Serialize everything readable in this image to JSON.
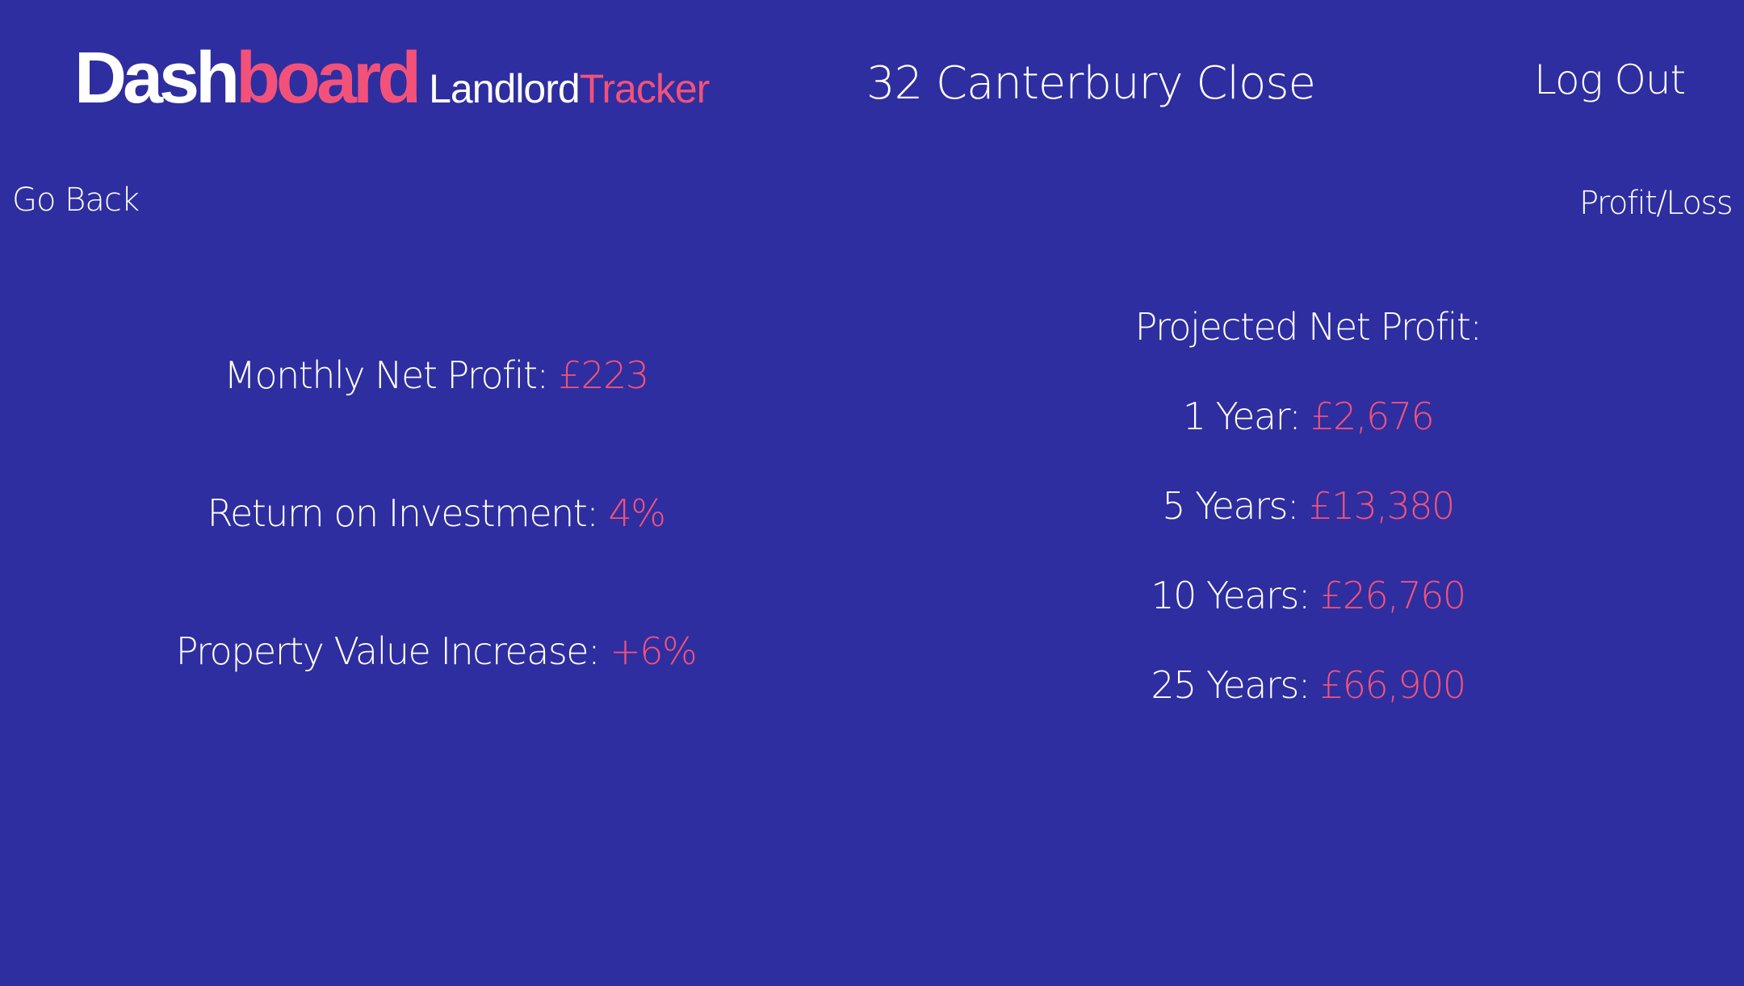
{
  "header": {
    "logo_part1": "Dash",
    "logo_part2": "board",
    "app_name_part1": "Landlord",
    "app_name_part2": "Tracker",
    "property_name": "32 Canterbury Close",
    "logout_label": "Log Out"
  },
  "nav": {
    "go_back_label": "Go Back",
    "profit_loss_label": "Profit/Loss"
  },
  "summary": {
    "monthly_net_profit_label": "Monthly Net Profit:",
    "monthly_net_profit_value": "£223",
    "roi_label": "Return on Investment:",
    "roi_value": "4%",
    "property_value_increase_label": "Property Value Increase:",
    "property_value_increase_value": "+6%"
  },
  "projection": {
    "heading": "Projected Net Profit:",
    "items": [
      {
        "label": "1 Year:",
        "value": "£2,676"
      },
      {
        "label": "5 Years:",
        "value": "£13,380"
      },
      {
        "label": "10 Years:",
        "value": "£26,760"
      },
      {
        "label": "25 Years:",
        "value": "£66,900"
      }
    ]
  },
  "colors": {
    "background": "#2e2ea0",
    "accent": "#f2527a",
    "text": "#ffffff"
  }
}
